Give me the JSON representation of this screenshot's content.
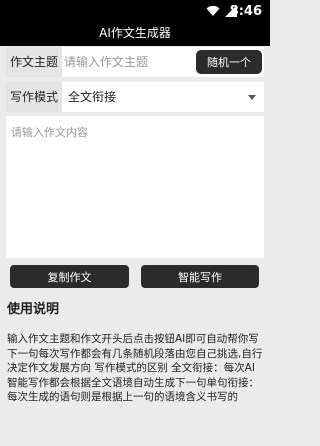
{
  "status_bar": {
    "time": "8:46",
    "icons": [
      "wifi-icon",
      "signal-icon"
    ]
  },
  "app": {
    "title": "AI作文生成器"
  },
  "form": {
    "topic_label": "作文主题",
    "topic_placeholder": "请输入作文主题",
    "topic_value": "",
    "random_button_label": "随机一个",
    "mode_label": "写作模式",
    "mode_selected": "全文衔接",
    "content_placeholder": "请输入作文内容",
    "content_value": ""
  },
  "actions": {
    "copy_label": "复制作文",
    "smart_write_label": "智能写作"
  },
  "help": {
    "title": "使用说明",
    "body": "输入作文主题和作文开头后点击按钮AI即可自动帮你写下一句每次写作都会有几条随机段落由您自己挑选,自行决定作文发展方向 写作模式的区别 全文衔接：每次AI智能写作都会根据全文语境自动生成下一句单句衔接：每次生成的语句则是根据上一句的语境含义书写的"
  },
  "colors": {
    "bar_background": "#000000",
    "button_background": "#2b2b2b",
    "page_background": "#ebebeb",
    "label_background": "#e4e4e4"
  }
}
